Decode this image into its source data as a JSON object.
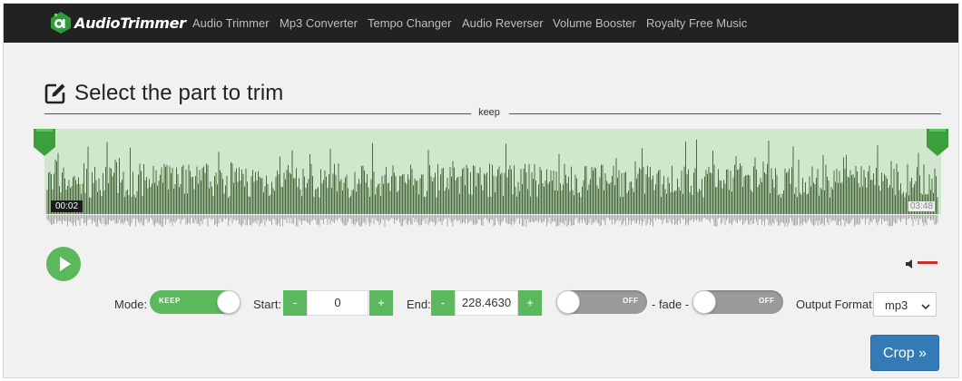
{
  "brand": {
    "name": "AudioTrimmer"
  },
  "nav": {
    "items": [
      {
        "label": "Audio Trimmer"
      },
      {
        "label": "Mp3 Converter"
      },
      {
        "label": "Tempo Changer"
      },
      {
        "label": "Audio Reverser"
      },
      {
        "label": "Volume Booster"
      },
      {
        "label": "Royalty Free Music"
      }
    ]
  },
  "page": {
    "title": "Select the part to trim",
    "region_label": "keep"
  },
  "player": {
    "selection_start_time": "00:02",
    "selection_end_time": "03:48",
    "icons": {
      "play": "play-icon",
      "volume": "speaker-icon"
    }
  },
  "controls": {
    "mode_label": "Mode:",
    "mode_value": "KEEP",
    "start_label": "Start:",
    "start_value": "0",
    "end_label": "End:",
    "end_value": "228.4630",
    "minus": "-",
    "plus": "+",
    "fade_in_state": "OFF",
    "fade_label": "- fade -",
    "fade_out_state": "OFF",
    "format_label": "Output Format",
    "format_value": "mp3",
    "crop_label": "Crop »"
  },
  "colors": {
    "accent_green": "#5cb85c",
    "waveform_dark": "#4b6a40",
    "selection_bg": "#cfe8cd",
    "crop_blue": "#337ab7",
    "volume_red": "#c9302c",
    "navbar": "#222222"
  }
}
